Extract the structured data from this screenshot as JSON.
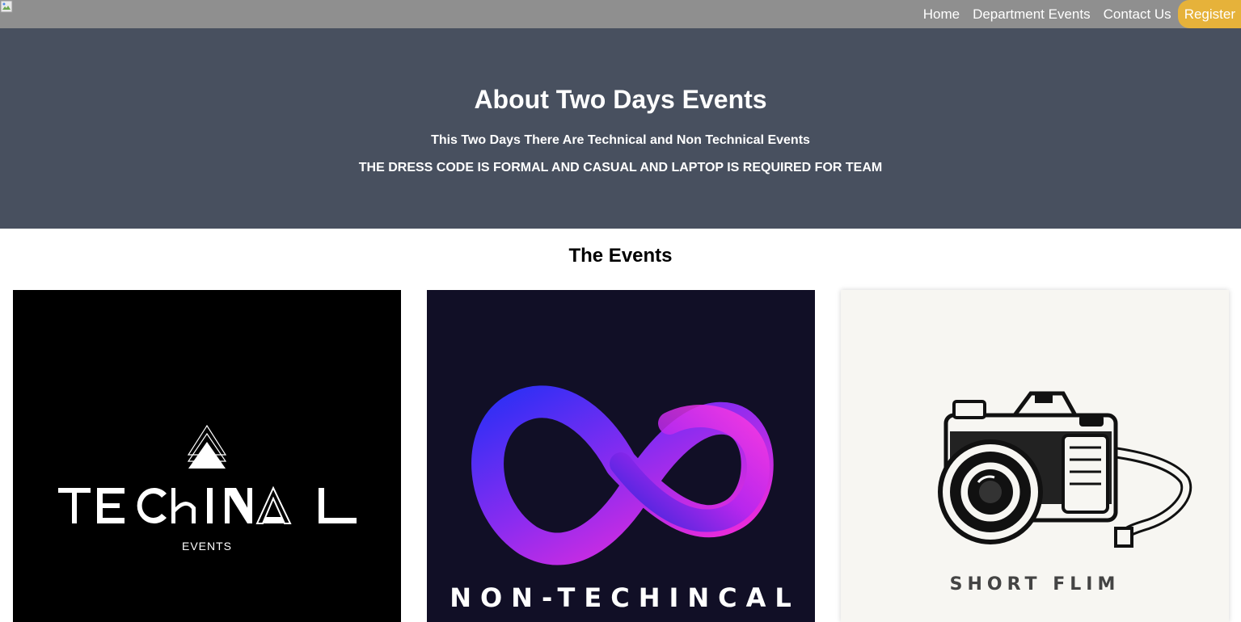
{
  "nav": {
    "home": "Home",
    "department_events": "Department Events",
    "contact_us": "Contact Us",
    "register": "Register"
  },
  "hero": {
    "title": "About Two Days Events",
    "line1": "This Two Days There Are Technical and Non Technical Events",
    "line2": "THE DRESS CODE IS FORMAL AND CASUAL AND LAPTOP IS REQUIRED FOR TEAM"
  },
  "events": {
    "title": "The Events",
    "cards": [
      {
        "logo_text": "TECHINAL",
        "logo_subtext": "EVENTS",
        "icon": "triangles-icon"
      },
      {
        "logo_text": "NON-TECHINCAL",
        "icon": "infinity-icon"
      },
      {
        "logo_text": "SHORT FLIM",
        "icon": "camera-icon"
      }
    ]
  },
  "colors": {
    "navbar": "#8f8f8f",
    "register": "#e6b23a",
    "hero": "#48505f"
  }
}
